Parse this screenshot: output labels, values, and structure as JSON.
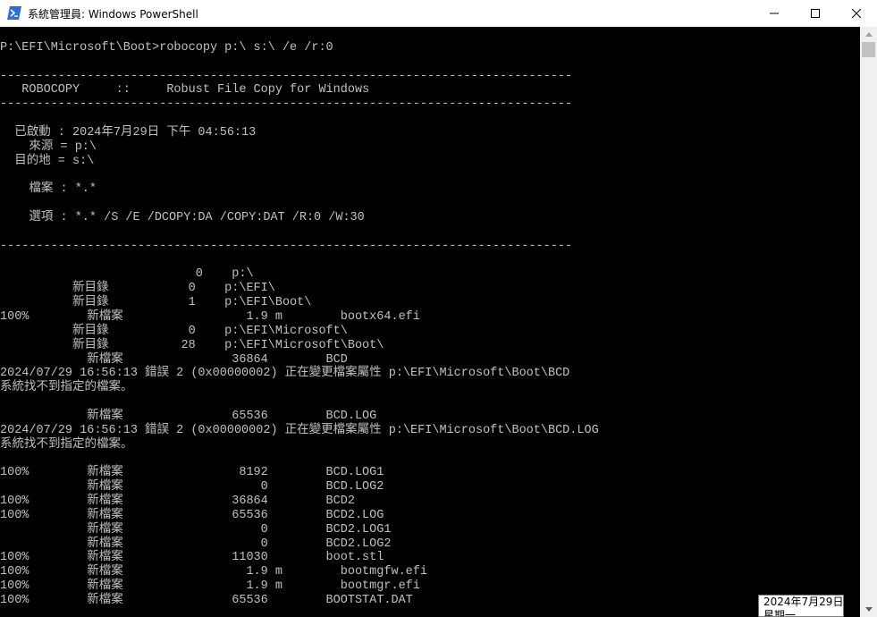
{
  "window": {
    "title": "系統管理員: Windows PowerShell",
    "icons": {
      "app": "powershell-icon",
      "minimize": "minimize-icon",
      "maximize": "maximize-icon",
      "close": "close-icon"
    }
  },
  "console": {
    "lines": [
      "",
      "P:\\EFI\\Microsoft\\Boot>robocopy p:\\ s:\\ /e /r:0",
      "",
      "-------------------------------------------------------------------------------",
      "   ROBOCOPY     ::     Robust File Copy for Windows",
      "-------------------------------------------------------------------------------",
      "",
      "  已啟動 : 2024年7月29日 下午 04:56:13",
      "    來源 = p:\\",
      "  目的地 = s:\\",
      "",
      "    檔案 : *.*",
      "",
      "    選項 : *.* /S /E /DCOPY:DA /COPY:DAT /R:0 /W:30",
      "",
      "-------------------------------------------------------------------------------",
      "",
      "                           0    p:\\",
      "          新目錄           0    p:\\EFI\\",
      "          新目錄           1    p:\\EFI\\Boot\\",
      "100%        新檔案                 1.9 m        bootx64.efi",
      "          新目錄           0    p:\\EFI\\Microsoft\\",
      "          新目錄          28    p:\\EFI\\Microsoft\\Boot\\",
      "            新檔案               36864        BCD",
      "2024/07/29 16:56:13 錯誤 2 (0x00000002) 正在變更檔案屬性 p:\\EFI\\Microsoft\\Boot\\BCD",
      "系統找不到指定的檔案。",
      "",
      "            新檔案               65536        BCD.LOG",
      "2024/07/29 16:56:13 錯誤 2 (0x00000002) 正在變更檔案屬性 p:\\EFI\\Microsoft\\Boot\\BCD.LOG",
      "系統找不到指定的檔案。",
      "",
      "100%        新檔案                8192        BCD.LOG1",
      "            新檔案                   0        BCD.LOG2",
      "100%        新檔案               36864        BCD2",
      "100%        新檔案               65536        BCD2.LOG",
      "            新檔案                   0        BCD2.LOG1",
      "            新檔案                   0        BCD2.LOG2",
      "100%        新檔案               11030        boot.stl",
      "100%        新檔案                 1.9 m        bootmgfw.efi",
      "100%        新檔案                 1.9 m        bootmgr.efi",
      "100%        新檔案               65536        BOOTSTAT.DAT"
    ]
  },
  "tooltip": {
    "date": "2024年7月29日",
    "weekday": "星期一"
  },
  "colors": {
    "console_bg": "#000000",
    "console_fg": "#c0c0c0",
    "titlebar_bg": "#ffffff",
    "scrollbar_bg": "#f0f0f0",
    "accent": "#2b6fd6"
  }
}
